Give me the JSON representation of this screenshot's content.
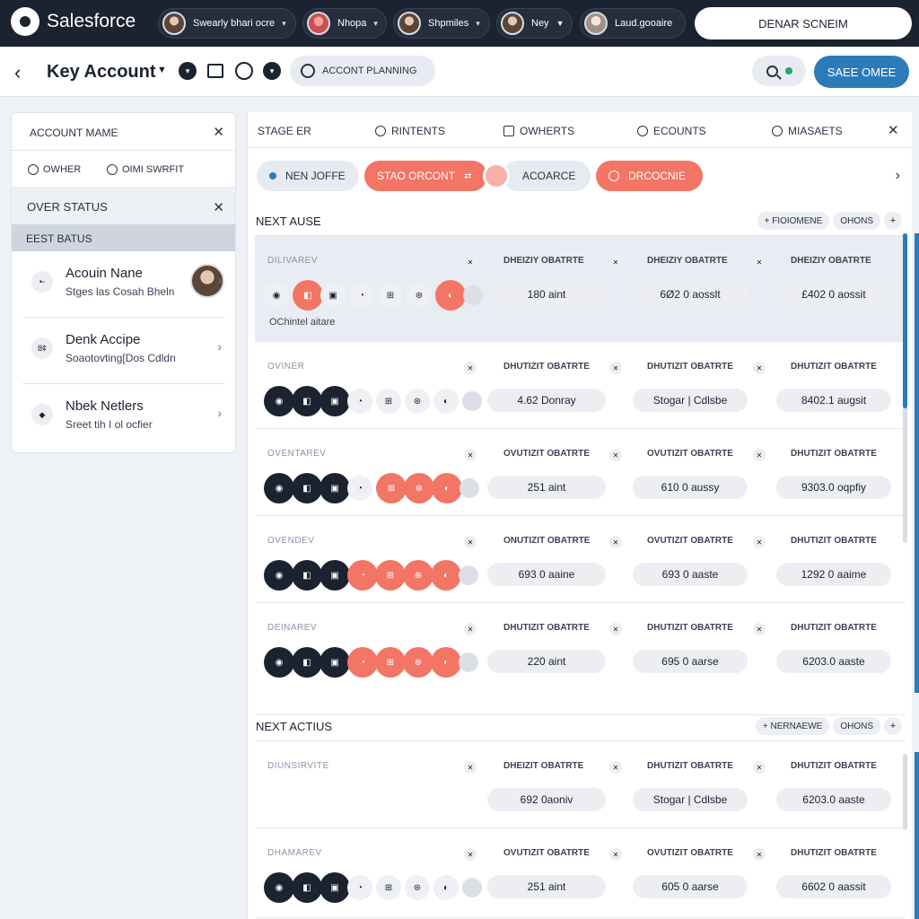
{
  "brand": {
    "name": "Salesforce"
  },
  "topbar": {
    "users": [
      {
        "name": "Swearly bhari ocre"
      },
      {
        "name": "Nhopa"
      },
      {
        "name": "Shpmiles"
      },
      {
        "name": "Ney"
      },
      {
        "name": "Laud.gooaire"
      }
    ],
    "action_label": "DENAR SCNEIM"
  },
  "header": {
    "title": "Key Account",
    "plan_label": "ACCONT PLANNING",
    "save_label": "SAEE OMEE"
  },
  "left_panel": {
    "account_name_label": "ACCOUNT MAME",
    "radio_owner": "OWHER",
    "radio_other": "OIMI SWRFIT",
    "over_status_label": "OVER STATUS",
    "best_status_label": "EEST BATUS",
    "cards": [
      {
        "title": "Acouin Nane",
        "subtitle": "Stges las Cosah Bheln",
        "icon": "•◦"
      },
      {
        "title": "Denk Accipe",
        "subtitle": "Soaotovting[Dos Cdldn",
        "icon": "8¢"
      },
      {
        "title": "Nbek Netlers",
        "subtitle": "Sreet tih I ol ocfier",
        "icon": "◆"
      }
    ]
  },
  "filters": {
    "items": [
      "STAGE ER",
      "RINTENTS",
      "OWHERTS",
      "ECOUNTS",
      "MIASAETS"
    ]
  },
  "chips": {
    "items": [
      {
        "label": "NEN JOFFE",
        "style": "grey"
      },
      {
        "label": "STAO ORCONT",
        "style": "coral"
      },
      {
        "label": "ACOARCE",
        "style": "grey"
      },
      {
        "label": "DRCOCNIE",
        "style": "coral"
      }
    ]
  },
  "sections": [
    {
      "title": "NEXT AUSE",
      "pill": "FIOIOMENE",
      "pill2": "OHONS",
      "rows": [
        {
          "label": "DILIVAREV",
          "columns": [
            "DHEIZIY OBATRTE",
            "DHEIZIY OBATRTE",
            "DHEIZIY OBATRTE"
          ],
          "values": [
            "180 aint",
            "6Ø2 0 aosslt",
            "£402 0 aossit"
          ],
          "note": "OChintel aitare"
        },
        {
          "label": "OVINER",
          "columns": [
            "DHUTIZIT OBATRTE",
            "DHUTIZIT OBATRTE",
            "DHUTIZIT OBATRTE"
          ],
          "values": [
            "4.62 Donray",
            "Stogar | Cdlsbe",
            "8402.1 augsit"
          ]
        },
        {
          "label": "OVENTAREV",
          "columns": [
            "OVUTIZIT OBATRTE",
            "OVUTIZIT OBATRTE",
            "DHUTIZIT OBATRTE"
          ],
          "values": [
            "251 aint",
            "610 0 aussy",
            "9303.0 oqpfiy"
          ]
        },
        {
          "label": "OVENDEV",
          "columns": [
            "ONUTIZIT OBATRTE",
            "OVUTIZIT OBATRTE",
            "DHUTIZIT OBATRTE"
          ],
          "values": [
            "693 0 aaine",
            "693 0 aaste",
            "1292 0 aaime"
          ]
        },
        {
          "label": "DEINAREV",
          "columns": [
            "DHUTIZIT OBATRTE",
            "DHUTIZIT OBATRTE",
            "DHUTIZIT OBATRTE"
          ],
          "values": [
            "220 aint",
            "695 0 aarse",
            "6203.0 aaste"
          ]
        }
      ]
    },
    {
      "title": "NEXT ACTIUS",
      "pill": "NERNAEWE",
      "pill2": "OHONS",
      "rows": [
        {
          "label": "DIUNSIRVITE",
          "columns": [
            "DHEIZIT OBATRTE",
            "DHUTIZIT OBATRTE",
            "DHUTIZIT OBATRTE"
          ],
          "values": [
            "692 0aoniv",
            "Stogar | Cdlsbe",
            "6203.0 aaste"
          ]
        },
        {
          "label": "DHAMAREV",
          "columns": [
            "OVUTIZIT OBATRTE",
            "OVUTIZIT OBATRTE",
            "DHUTIZIT OBATRTE"
          ],
          "values": [
            "251 aint",
            "605 0 aarse",
            "6602 0 aassit"
          ]
        }
      ]
    }
  ],
  "colors": {
    "navy": "#1b2230",
    "coral": "#f27565",
    "blue": "#2b7bb9"
  }
}
